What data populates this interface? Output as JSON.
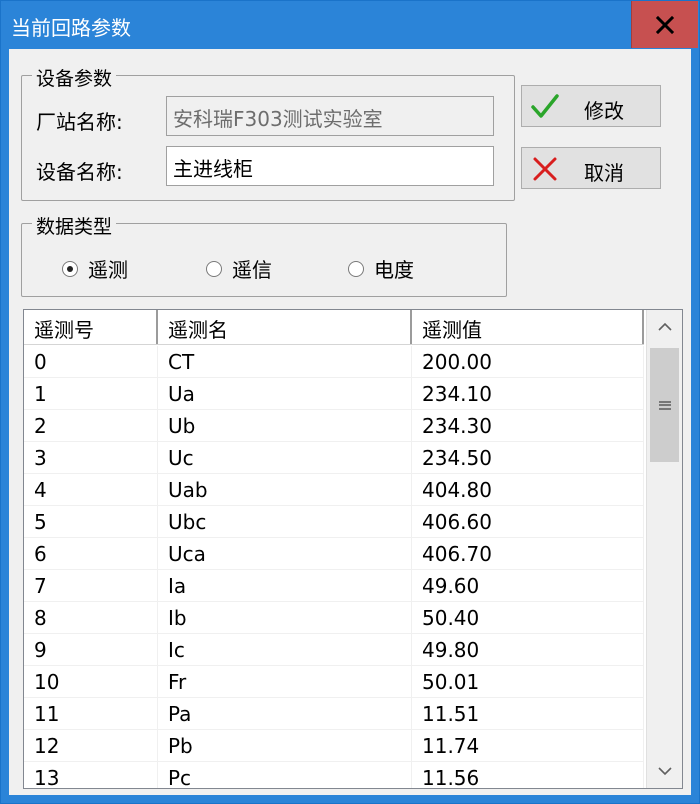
{
  "window": {
    "title": "当前回路参数"
  },
  "device_params": {
    "legend": "设备参数",
    "station_label": "厂站名称:",
    "station_value": "安科瑞F303测试实验室",
    "device_label": "设备名称:",
    "device_value": "主进线柜"
  },
  "buttons": {
    "modify_label": "修改",
    "cancel_label": "取消"
  },
  "data_type": {
    "legend": "数据类型",
    "options": [
      "遥测",
      "遥信",
      "电度"
    ],
    "selected": "遥测"
  },
  "table": {
    "columns": [
      "遥测号",
      "遥测名",
      "遥测值"
    ],
    "rows": [
      [
        "0",
        "CT",
        "200.00"
      ],
      [
        "1",
        "Ua",
        "234.10"
      ],
      [
        "2",
        "Ub",
        "234.30"
      ],
      [
        "3",
        "Uc",
        "234.50"
      ],
      [
        "4",
        "Uab",
        "404.80"
      ],
      [
        "5",
        "Ubc",
        "406.60"
      ],
      [
        "6",
        "Uca",
        "406.70"
      ],
      [
        "7",
        "Ia",
        "49.60"
      ],
      [
        "8",
        "Ib",
        "50.40"
      ],
      [
        "9",
        "Ic",
        "49.80"
      ],
      [
        "10",
        "Fr",
        "50.01"
      ],
      [
        "11",
        "Pa",
        "11.51"
      ],
      [
        "12",
        "Pb",
        "11.74"
      ],
      [
        "13",
        "Pc",
        "11.56"
      ]
    ]
  },
  "icons": {
    "close": "close-icon",
    "modify": "checkmark-icon",
    "cancel": "x-icon",
    "scroll_up": "chevron-up-icon",
    "scroll_down": "chevron-down-icon"
  },
  "colors": {
    "titlebar": "#2b84d8",
    "close_button": "#c75050",
    "check_green": "#2aa52a",
    "cancel_red": "#d81e1e"
  }
}
